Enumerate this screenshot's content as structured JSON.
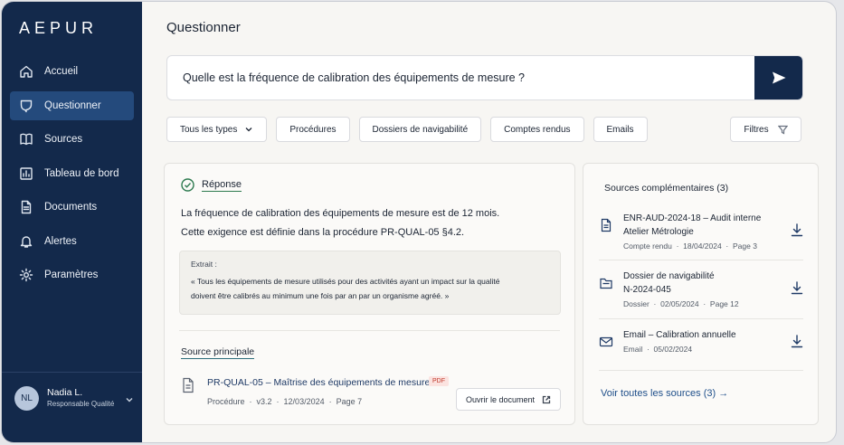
{
  "brand": "AEPUR",
  "sidebar": {
    "items": [
      {
        "label": "Accueil",
        "icon": "home-icon"
      },
      {
        "label": "Questionner",
        "icon": "chat-icon",
        "active": true
      },
      {
        "label": "Sources",
        "icon": "book-icon"
      },
      {
        "label": "Tableau de bord",
        "icon": "chart-icon"
      },
      {
        "label": "Documents",
        "icon": "document-icon"
      },
      {
        "label": "Alertes",
        "icon": "bell-icon"
      },
      {
        "label": "Paramètres",
        "icon": "gear-icon"
      }
    ],
    "user": {
      "initials": "NL",
      "name": "Nadia L.",
      "role": "Responsable Qualité"
    }
  },
  "header": {
    "title": "Questionner"
  },
  "search": {
    "value": "Quelle est la fréquence de calibration des équipements de mesure ?"
  },
  "chips": [
    "Tous les types",
    "Procédures",
    "Dossiers de navigabilité",
    "Comptes rendus",
    "Emails"
  ],
  "filters_label": "Filtres",
  "answer": {
    "title": "Réponse",
    "line1": "La fréquence de calibration des équipements de mesure est de 12 mois.",
    "line2": "Cette exigence est définie dans la procédure PR-QUAL-05 §4.2.",
    "extract_label": "Extrait :",
    "extract_line1": "« Tous les équipements de mesure utilisés pour des activités ayant un impact sur la qualité",
    "extract_line2": "doivent être calibrés au minimum une fois par an par un organisme agréé. »",
    "source_title": "Source principale",
    "doc": {
      "title": "PR-QUAL-05 – Maîtrise des équipements de mesure",
      "badge": "PDF",
      "type": "Procédure",
      "version": "v3.2",
      "date": "12/03/2024",
      "page": "Page 7"
    },
    "open_label": "Ouvrir le document"
  },
  "sources": {
    "title": "Sources complémentaires (3)",
    "items": [
      {
        "title1": "ENR-AUD-2024-18 – Audit interne",
        "title2": "Atelier Métrologie",
        "type": "Compte rendu",
        "date": "18/04/2024",
        "page": "Page 3",
        "icon": "document-icon"
      },
      {
        "title1": "Dossier de navigabilité",
        "title2": "N-2024-045",
        "type": "Dossier",
        "date": "02/05/2024",
        "page": "Page 12",
        "icon": "folder-icon"
      },
      {
        "title1": "Email – Calibration annuelle",
        "title2": "",
        "type": "Email",
        "date": "05/02/2024",
        "page": "",
        "icon": "mail-icon"
      }
    ],
    "all_label": "Voir toutes les sources (3) →"
  },
  "colors": {
    "sidebar": "#13294b",
    "active": "#244a7c",
    "accent": "#1f4f8a",
    "success": "#2d7a4f",
    "pdf": "#c0392b"
  }
}
